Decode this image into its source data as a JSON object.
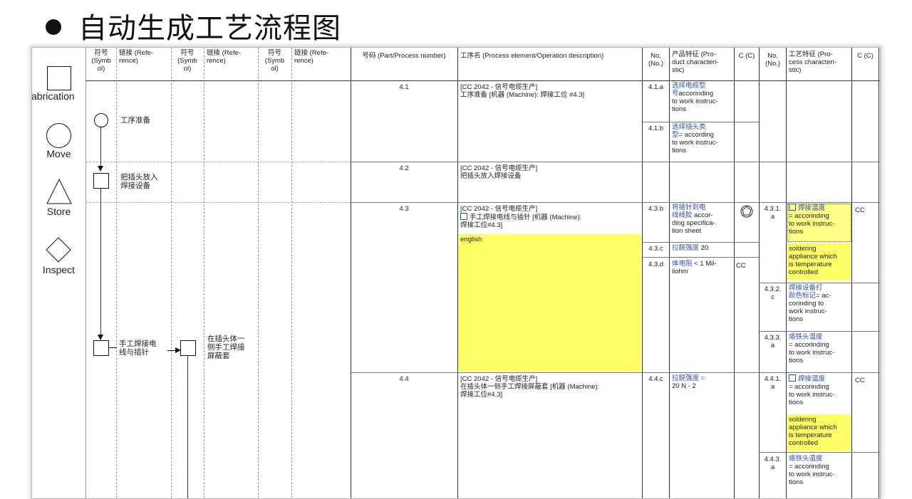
{
  "slide_title": "自动生成工艺流程图",
  "palette": [
    {
      "label": "abrication",
      "icon": "square-icon"
    },
    {
      "label": "Move",
      "icon": "circle-icon"
    },
    {
      "label": "Store",
      "icon": "triangle-icon"
    },
    {
      "label": "Inspect",
      "icon": "diamond-icon"
    }
  ],
  "headers": {
    "symbol1": "符号\n(Symb\nol)",
    "ref1": "链接 (Refe-\nrence)",
    "symbol2": "符号\n(Symb\nol)",
    "ref2": "链接 (Refe-\nrence)",
    "symbol3": "符号\n(Symb\nol)",
    "ref3": "链接 (Refe-\nrence)",
    "part_no": "号码 (Part/Process number)",
    "process": "工序名 (Process element/Operation description)",
    "no1": "No.\n(No.)",
    "product_char": "产品特征 (Pro-\nduct characteri-\nstic)",
    "c1": "C (C)",
    "no2": "No.\n(No.)",
    "process_char": "工艺特征 (Pro-\ncess characteri-\nstic)",
    "c2": "C (C)"
  },
  "flow_labels": {
    "step1": "工序准备",
    "step2": "把插头放入\n焊接设备",
    "step3": "手工焊接电\n线与插针",
    "step3b": "在插头体一\n侧手工焊接\n屏蔽套"
  },
  "rows": [
    {
      "part": "4.1",
      "process": "[CC 2042 - 信号电缆生产]\n工序准备 [机器 (Machine): 焊接工位 #4.3]",
      "product_items": [
        {
          "no": "4.1.a",
          "text_cn": "选择电缆型\n号",
          "text_en": "accorinding\nto work instruc-\ntions"
        },
        {
          "no": "4.1.b",
          "text_cn": "选择插头类\n型",
          "text_en": "= according\nto work instruc-\ntions"
        }
      ]
    },
    {
      "part": "4.2",
      "process": "[CC 2042 - 信号电缆生产]\n把插头放入焊接设备"
    },
    {
      "part": "4.3",
      "process_line1": "[CC 2042 - 信号电缆生产]",
      "process_line2": "手工焊接电线与插针 [机器 (Machine):\n焊接工位#4.3]",
      "process_note": "english",
      "product_items": [
        {
          "no": "4.3.b",
          "text_cn": "将插针到电\n线线胶",
          "text_en": "accor-\nding specifica-\ntion sheet"
        },
        {
          "no": "4.3.c",
          "text_cn": "拉脱强度",
          "text_en": "20"
        },
        {
          "no": "4.3.d",
          "text_cn": "体电阻",
          "text_en": "< 1 Mil-\nliohm",
          "c": "CC"
        }
      ],
      "process_items": [
        {
          "no": "4.3.1.\na",
          "text_cn": "焊接温度",
          "text_en": "= accorinding\nto work instruc-\ntions",
          "note": "soldering\nappliance which\nis temperature\ncontrolled",
          "c": "CC"
        },
        {
          "no": "4.3.2.\nc",
          "text_cn": "焊接设备打\n颜色标记",
          "text_en": "= ac-\ncorinding to\nwork instruc-\ntions"
        },
        {
          "no": "4.3.3.\na",
          "text_cn": "烙铁头温度",
          "text_en": "= accorinding\nto work instruc-\ntions"
        }
      ]
    },
    {
      "part": "4.4",
      "process": "[CC 2042 - 信号电缆生产]\n在插头体一侧手工焊接屏蔽套 [机器 (Machine):\n焊接工位#4.3]",
      "product_items": [
        {
          "no": "4.4.c",
          "text_cn": "拉脱强度 =",
          "text_en": "20 N - 2"
        }
      ],
      "process_items": [
        {
          "no": "4.4.1.\na",
          "text_cn": "焊接温度",
          "text_en": "= accorinding\nto work instruc-\ntions",
          "note": "soldering\nappliance which\nis temperature\ncontrolled",
          "c": "CC"
        },
        {
          "no": "4.4.3.\na",
          "text_cn": "烙铁头温度",
          "text_en": "= accorinding\nto work instruc-\ntions"
        }
      ]
    }
  ],
  "colors": {
    "highlight": "#ffff66",
    "link_text": "#2f4fa8"
  }
}
